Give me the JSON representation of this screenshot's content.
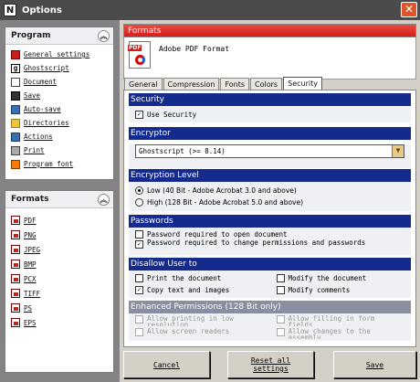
{
  "window": {
    "title": "Options",
    "app_icon_letter": "N"
  },
  "program_panel": {
    "title": "Program",
    "items": [
      {
        "label": "General settings",
        "icon": "settings-icon"
      },
      {
        "label": "Ghostscript",
        "icon": "ghostscript-icon"
      },
      {
        "label": "Document",
        "icon": "document-icon"
      },
      {
        "label": "Save",
        "icon": "floppy-icon"
      },
      {
        "label": "Auto-save",
        "icon": "autosave-icon"
      },
      {
        "label": "Directories",
        "icon": "folder-icon"
      },
      {
        "label": "Actions",
        "icon": "actions-icon"
      },
      {
        "label": "Print",
        "icon": "printer-icon"
      },
      {
        "label": "Program font",
        "icon": "font-icon"
      }
    ]
  },
  "formats_panel": {
    "title": "Formats",
    "items": [
      "PDF",
      "PNG",
      "JPEG",
      "BMP",
      "PCX",
      "TIFF",
      "PS",
      "EPS"
    ]
  },
  "main": {
    "header_title": "Formats",
    "format_name": "Adobe PDF Format",
    "pdf_logo_text": "PDF",
    "tabs": [
      "General",
      "Compression",
      "Fonts",
      "Colors",
      "Security"
    ],
    "active_tab": "Security"
  },
  "security": {
    "section_title": "Security",
    "use_security_label": "Use Security",
    "use_security_checked": true,
    "encryptor": {
      "title": "Encryptor",
      "selected": "Ghostscript (>= 8.14)"
    },
    "encryption_level": {
      "title": "Encryption Level",
      "options": [
        "Low (40 Bit - Adobe Acrobat 3.0 and above)",
        "High (128 Bit - Adobe Acrobat 5.0 and above)"
      ],
      "selected": 0
    },
    "passwords": {
      "title": "Passwords",
      "items": [
        {
          "label": "Password required to open document",
          "checked": false
        },
        {
          "label": "Password required to change permissions and passwords",
          "checked": true
        }
      ]
    },
    "disallow": {
      "title": "Disallow User to",
      "items": [
        {
          "label": "Print the document",
          "checked": false
        },
        {
          "label": "Modify the document",
          "checked": false
        },
        {
          "label": "Copy text and images",
          "checked": true
        },
        {
          "label": "Modify comments",
          "checked": false
        }
      ]
    },
    "enhanced": {
      "title": "Enhanced Permissions (128 Bit only)",
      "items": [
        "Allow printing in low resolution",
        "Allow filling in form fields",
        "Allow screen readers",
        "Allow changes to the assembly"
      ]
    }
  },
  "buttons": {
    "cancel": "Cancel",
    "reset": "Reset all settings",
    "save": "Save"
  },
  "colors": {
    "section_header": "#142a8c",
    "formats_bar": "#d41c1c",
    "window_frame": "#4b4b4b"
  }
}
